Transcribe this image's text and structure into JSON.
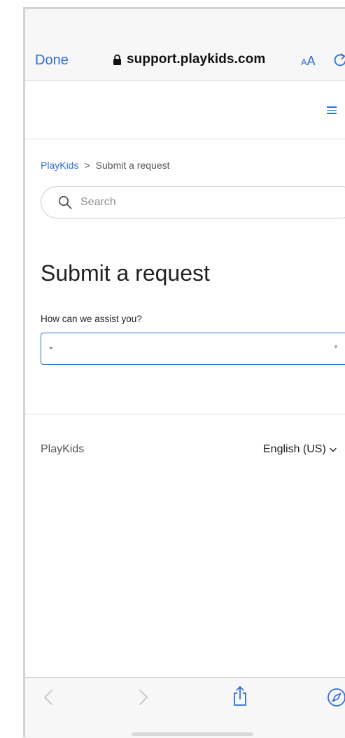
{
  "browser": {
    "done_label": "Done",
    "url": "support.playkids.com",
    "aa_small": "A",
    "aa_big": "A"
  },
  "breadcrumb": {
    "home": "PlayKids",
    "separator": ">",
    "current": "Submit a request"
  },
  "search": {
    "placeholder": "Search",
    "value": ""
  },
  "page": {
    "title": "Submit a request"
  },
  "form": {
    "label": "How can we assist you?",
    "selected_value": "-",
    "caret": "▼"
  },
  "footer": {
    "brand": "PlayKids",
    "language": "English (US)"
  },
  "colors": {
    "accent": "#2f6fd6",
    "toolbar_bg": "#f7f7f7",
    "text_muted": "#555555"
  },
  "icons": {
    "url_lock": "lock-icon",
    "reload": "reload-icon",
    "menu": "hamburger-menu-icon",
    "search": "magnifier-icon",
    "language": "chevron-down-icon",
    "back": "chevron-left-icon",
    "forward": "chevron-right-icon",
    "share": "share-icon",
    "safari": "compass-icon"
  }
}
